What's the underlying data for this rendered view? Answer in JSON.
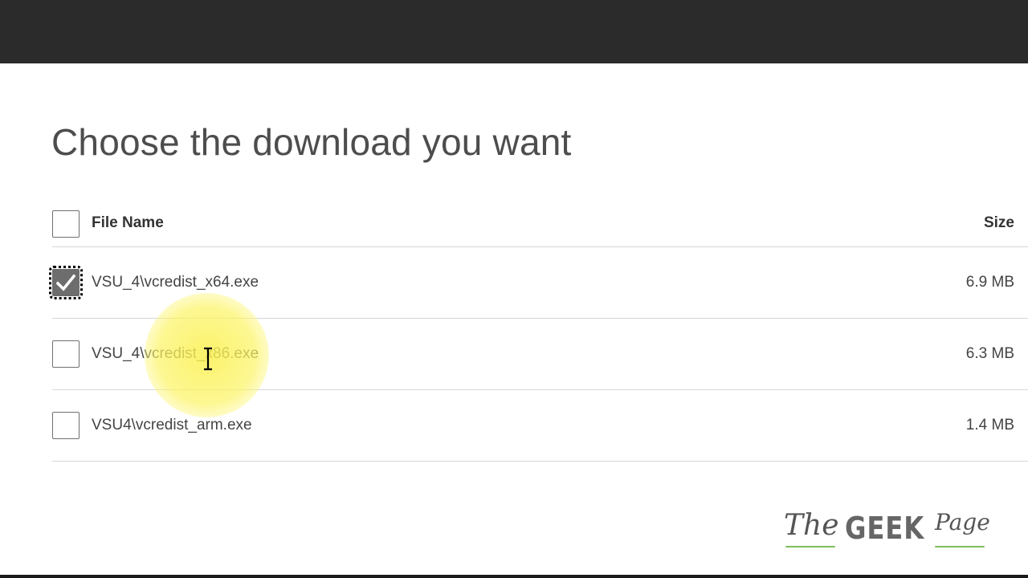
{
  "page": {
    "title": "Choose the download you want"
  },
  "table": {
    "header": {
      "name": "File Name",
      "size": "Size",
      "checked": false
    },
    "files": [
      {
        "name": "VSU_4\\vcredist_x64.exe",
        "size": "6.9 MB",
        "checked": true
      },
      {
        "name": "VSU_4\\vcredist_x86.exe",
        "size": "6.3 MB",
        "checked": false
      },
      {
        "name": "VSU4\\vcredist_arm.exe",
        "size": "1.4 MB",
        "checked": false
      }
    ]
  },
  "watermark": {
    "the": "The",
    "geek": "GEEK",
    "page": "Page"
  },
  "colors": {
    "topbar": "#2b2b2b",
    "highlight": "#f7ea4f",
    "watermark_underline": "#7cbf5a"
  }
}
